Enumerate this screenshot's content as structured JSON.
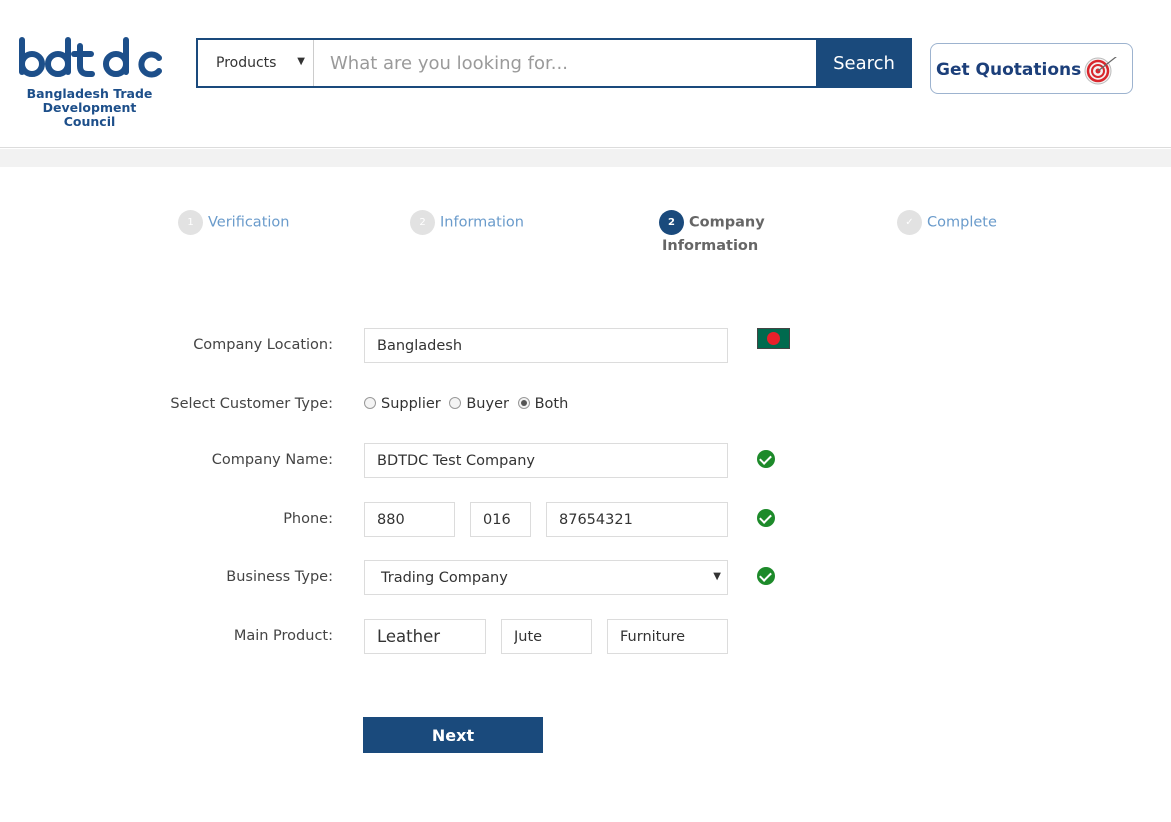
{
  "header": {
    "logo_text": "bdtdc",
    "logo_subtitle_line1": "Bangladesh Trade",
    "logo_subtitle_line2": "Development Council",
    "search": {
      "category": "Products",
      "placeholder": "What are you looking for...",
      "button_label": "Search"
    },
    "quote_button_label": "Get Quotations"
  },
  "steps": [
    {
      "number": "1",
      "label": "Verification",
      "state": "done"
    },
    {
      "number": "2",
      "label": "Information",
      "state": "done"
    },
    {
      "number": "2",
      "label_line1": "Company",
      "label_line2": "Information",
      "state": "active"
    },
    {
      "number": "✓",
      "label": "Complete",
      "state": "pending"
    }
  ],
  "form": {
    "company_location": {
      "label": "Company Location:",
      "value": "Bangladesh"
    },
    "customer_type": {
      "label": "Select Customer Type:",
      "options": [
        "Supplier",
        "Buyer",
        "Both"
      ],
      "selected": "Both"
    },
    "company_name": {
      "label": "Company Name:",
      "value": "BDTDC Test Company"
    },
    "phone": {
      "label": "Phone:",
      "country_code": "880",
      "area_code": "016",
      "number": "87654321"
    },
    "business_type": {
      "label": "Business Type:",
      "value": "Trading Company"
    },
    "main_product": {
      "label": "Main Product:",
      "values": [
        "Leather",
        "Jute",
        "Furniture"
      ]
    },
    "next_label": "Next"
  },
  "colors": {
    "primary": "#1a4a7c",
    "step_link": "#6a9bcb",
    "valid_check": "#1d8a2a"
  }
}
